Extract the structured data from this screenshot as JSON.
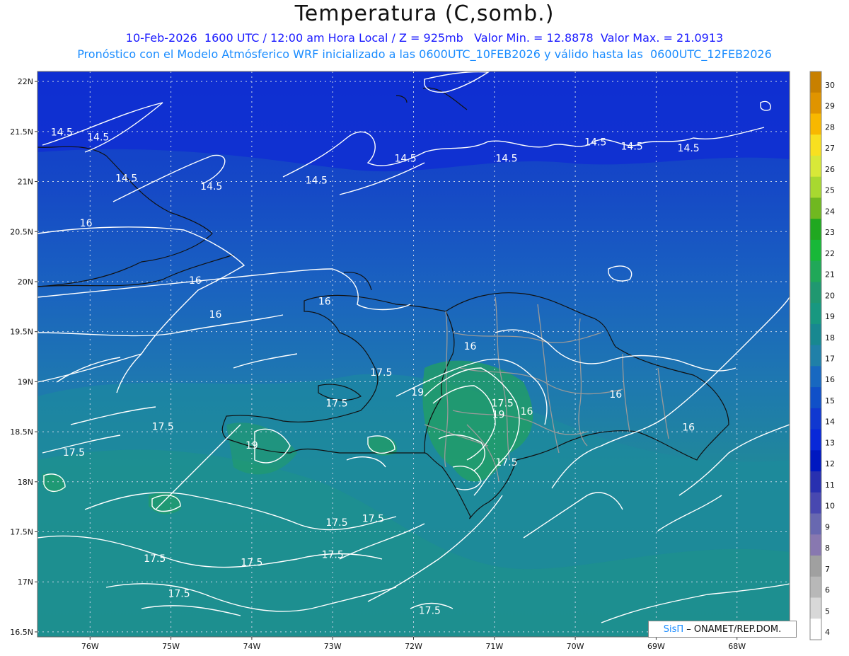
{
  "title": "Temperatura (C,somb.)",
  "subtitle_line1": "10-Feb-2026  1600 UTC / 12:00 am Hora Local / Z = 925mb   Valor Min. = 12.8878  Valor Max. = 21.0913",
  "subtitle_line2": "Pronóstico con el Modelo Atmósferico WRF inicializado a las 0600UTC_10FEB2026 y válido hasta las  0600UTC_12FEB2026",
  "credit": {
    "logo": "SisΠ",
    "text": "– ONAMET/REP.DOM."
  },
  "map": {
    "lon_range": [
      -76.65,
      -67.35
    ],
    "lat_range": [
      16.45,
      22.1
    ],
    "lat_ticks": [
      "22N",
      "21.5N",
      "21N",
      "20.5N",
      "20N",
      "19.5N",
      "19N",
      "18.5N",
      "18N",
      "17.5N",
      "17N",
      "16.5N"
    ],
    "lat_values": [
      22,
      21.5,
      21,
      20.5,
      20,
      19.5,
      19,
      18.5,
      18,
      17.5,
      17,
      16.5
    ],
    "lon_ticks": [
      "76W",
      "75W",
      "74W",
      "73W",
      "72W",
      "71W",
      "70W",
      "69W",
      "68W"
    ],
    "lon_values": [
      -76,
      -75,
      -74,
      -73,
      -72,
      -71,
      -70,
      -69,
      -68
    ]
  },
  "colorbar": {
    "levels": [
      "30",
      "29",
      "28",
      "27",
      "26",
      "25",
      "24",
      "23",
      "22",
      "21",
      "20",
      "19",
      "18",
      "17",
      "16",
      "15",
      "14",
      "13",
      "12",
      "11",
      "10",
      "9",
      "8",
      "7",
      "6",
      "5",
      "4"
    ],
    "colors": [
      "#c88000",
      "#e09400",
      "#f8b800",
      "#f8e020",
      "#d8e838",
      "#a8d830",
      "#70b820",
      "#20a820",
      "#18b838",
      "#20a858",
      "#209870",
      "#189880",
      "#188890",
      "#2080a8",
      "#1868c0",
      "#1050c8",
      "#1038d0",
      "#0828d8",
      "#0018c0",
      "#2830b0",
      "#4848b0",
      "#6868b0",
      "#8878b0",
      "#a0a0a0",
      "#b8b8b8",
      "#d8d8d8",
      "#ffffff"
    ]
  },
  "contour_labels": [
    {
      "text": "14.5",
      "lon": -76.35,
      "lat": 21.46
    },
    {
      "text": "14.5",
      "lon": -75.9,
      "lat": 21.41
    },
    {
      "text": "14.5",
      "lon": -75.55,
      "lat": 21.0
    },
    {
      "text": "14.5",
      "lon": -74.5,
      "lat": 20.92
    },
    {
      "text": "14.5",
      "lon": -73.2,
      "lat": 20.98
    },
    {
      "text": "14.5",
      "lon": -72.1,
      "lat": 21.2
    },
    {
      "text": "14.5",
      "lon": -70.85,
      "lat": 21.2
    },
    {
      "text": "14.5",
      "lon": -69.75,
      "lat": 21.36
    },
    {
      "text": "14.5",
      "lon": -69.3,
      "lat": 21.32
    },
    {
      "text": "14.5",
      "lon": -68.6,
      "lat": 21.3
    },
    {
      "text": "16",
      "lon": -76.05,
      "lat": 20.55
    },
    {
      "text": "16",
      "lon": -74.7,
      "lat": 19.98
    },
    {
      "text": "16",
      "lon": -74.45,
      "lat": 19.64
    },
    {
      "text": "16",
      "lon": -73.1,
      "lat": 19.77
    },
    {
      "text": "16",
      "lon": -71.3,
      "lat": 19.32
    },
    {
      "text": "16",
      "lon": -70.6,
      "lat": 18.67
    },
    {
      "text": "16",
      "lon": -69.5,
      "lat": 18.84
    },
    {
      "text": "16",
      "lon": -68.6,
      "lat": 18.51
    },
    {
      "text": "17.5",
      "lon": -72.4,
      "lat": 19.06
    },
    {
      "text": "17.5",
      "lon": -72.95,
      "lat": 18.75
    },
    {
      "text": "17.5",
      "lon": -75.1,
      "lat": 18.52
    },
    {
      "text": "17.5",
      "lon": -76.2,
      "lat": 18.26
    },
    {
      "text": "17.5",
      "lon": -70.9,
      "lat": 18.75
    },
    {
      "text": "17.5",
      "lon": -70.85,
      "lat": 18.16
    },
    {
      "text": "17.5",
      "lon": -72.95,
      "lat": 17.56
    },
    {
      "text": "17.5",
      "lon": -72.5,
      "lat": 17.6
    },
    {
      "text": "17.5",
      "lon": -74.0,
      "lat": 17.16
    },
    {
      "text": "17.5",
      "lon": -73.0,
      "lat": 17.24
    },
    {
      "text": "17.5",
      "lon": -75.2,
      "lat": 17.2
    },
    {
      "text": "17.5",
      "lon": -74.9,
      "lat": 16.85
    },
    {
      "text": "17.5",
      "lon": -71.8,
      "lat": 16.68
    },
    {
      "text": "19",
      "lon": -71.95,
      "lat": 18.86
    },
    {
      "text": "19",
      "lon": -70.95,
      "lat": 18.64
    },
    {
      "text": "19",
      "lon": -74.0,
      "lat": 18.33
    }
  ]
}
